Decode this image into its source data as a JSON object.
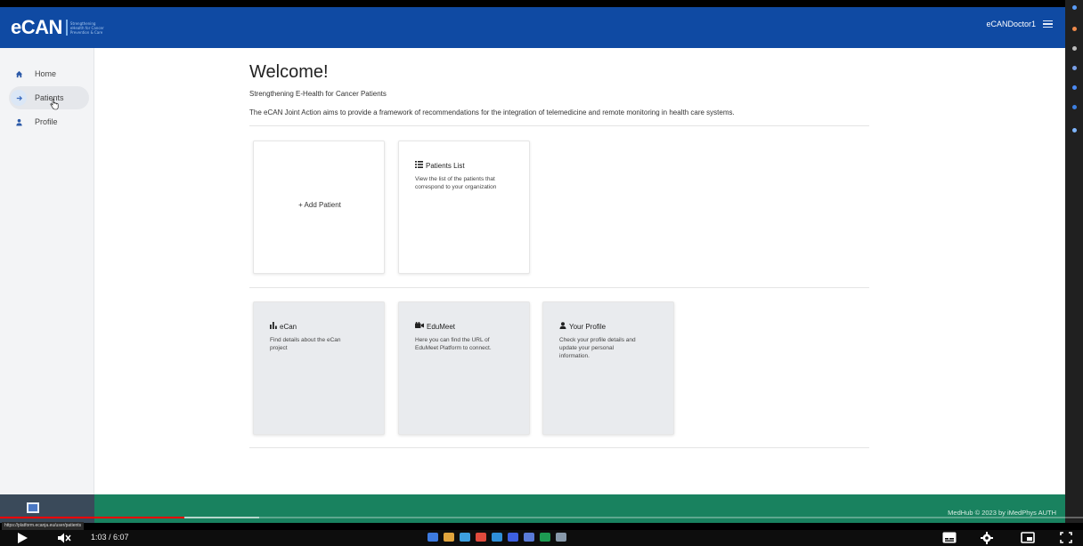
{
  "app": {
    "logo": "eCAN",
    "logo_tagline": [
      "Strengthening",
      "eHealth for Cancer",
      "Prevention & Care"
    ],
    "user": "eCANDoctor1"
  },
  "sidebar": {
    "items": [
      {
        "label": "Home",
        "icon": "home-icon"
      },
      {
        "label": "Patients",
        "icon": "arrow-right-icon",
        "active": true
      },
      {
        "label": "Profile",
        "icon": "user-icon"
      }
    ]
  },
  "main": {
    "title": "Welcome!",
    "subtitle": "Strengthening E-Health for Cancer Patients",
    "description": "The eCAN Joint Action aims to provide a framework of recommendations for the integration of telemedicine and remote monitoring in health care systems.",
    "add_patient": "+ Add Patient",
    "cards": {
      "patients_list": {
        "title": "Patients List",
        "text": "View the list of the patients that correspond to your organization"
      },
      "ecan": {
        "title": "eCan",
        "text": "Find details about the eCan project"
      },
      "edumeet": {
        "title": "EduMeet",
        "text": "Here you can find the URL of EduMeet Platform to connect."
      },
      "your_profile": {
        "title": "Your Profile",
        "text": "Check your profile details and update your personal information."
      }
    }
  },
  "footer": {
    "text": "MedHub © 2023 by iMedPhys AUTH"
  },
  "video": {
    "url_hint": "https://platform.ecanja.eu/user/patients",
    "time": "1:03 / 6:07",
    "played_fraction": 0.17,
    "buffered_fraction": 0.19
  },
  "colors": {
    "topbar": "#0f4aa3",
    "footer": "#19825f",
    "progress": "#ff0000"
  }
}
